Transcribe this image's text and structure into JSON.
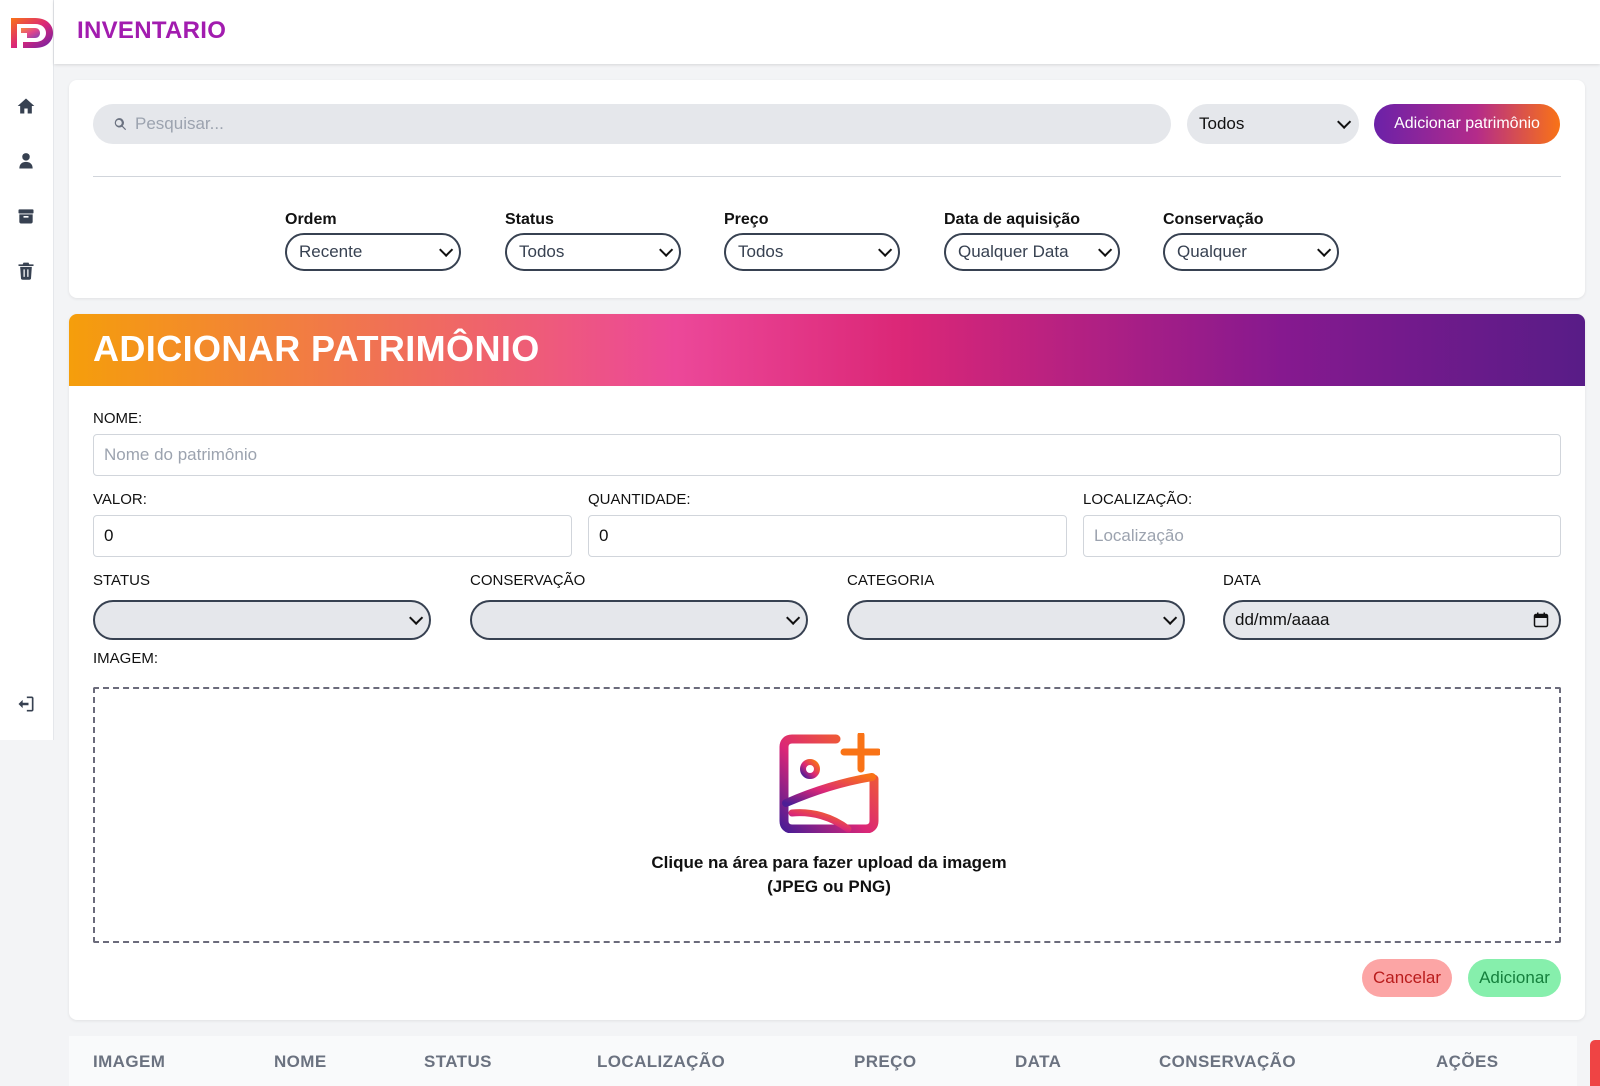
{
  "app": {
    "title": "INVENTARIO"
  },
  "sidebar": {
    "items": [
      {
        "name": "home",
        "icon": "home-icon"
      },
      {
        "name": "user",
        "icon": "user-icon"
      },
      {
        "name": "archive",
        "icon": "archive-icon"
      },
      {
        "name": "trash",
        "icon": "trash-icon"
      }
    ],
    "logout_icon": "logout-icon"
  },
  "toolbar": {
    "search_placeholder": "Pesquisar...",
    "category_select": "Todos",
    "add_button": "Adicionar patrimônio"
  },
  "filters": [
    {
      "label": "Ordem",
      "value": "Recente"
    },
    {
      "label": "Status",
      "value": "Todos"
    },
    {
      "label": "Preço",
      "value": "Todos"
    },
    {
      "label": "Data de aquisição",
      "value": "Qualquer Data"
    },
    {
      "label": "Conservação",
      "value": "Qualquer"
    }
  ],
  "form": {
    "title": "ADICIONAR PATRIMÔNIO",
    "nome_label": "NOME:",
    "nome_placeholder": "Nome do patrimônio",
    "valor_label": "VALOR:",
    "valor_value": "0",
    "quantidade_label": "QUANTIDADE:",
    "quantidade_value": "0",
    "localizacao_label": "LOCALIZAÇÃO:",
    "localizacao_placeholder": "Localização",
    "status_label": "STATUS",
    "conservacao_label": "CONSERVAÇÃO",
    "categoria_label": "CATEGORIA",
    "data_label": "DATA",
    "data_placeholder": "dd/mm/aaaa",
    "imagem_label": "IMAGEM:",
    "upload_line1": "Clique na área para fazer upload da imagem",
    "upload_line2": "(JPEG ou PNG)",
    "cancel_button": "Cancelar",
    "submit_button": "Adicionar"
  },
  "table": {
    "columns": [
      "IMAGEM",
      "NOME",
      "STATUS",
      "LOCALIZAÇÃO",
      "PREÇO",
      "DATA",
      "CONSERVAÇÃO",
      "AÇÕES"
    ]
  },
  "colors": {
    "brand": "#a21caf",
    "gradient_start": "#f59e0b",
    "gradient_mid": "#db2777",
    "gradient_end": "#581c87",
    "cancel": "#fca5a5",
    "confirm": "#86efac"
  }
}
